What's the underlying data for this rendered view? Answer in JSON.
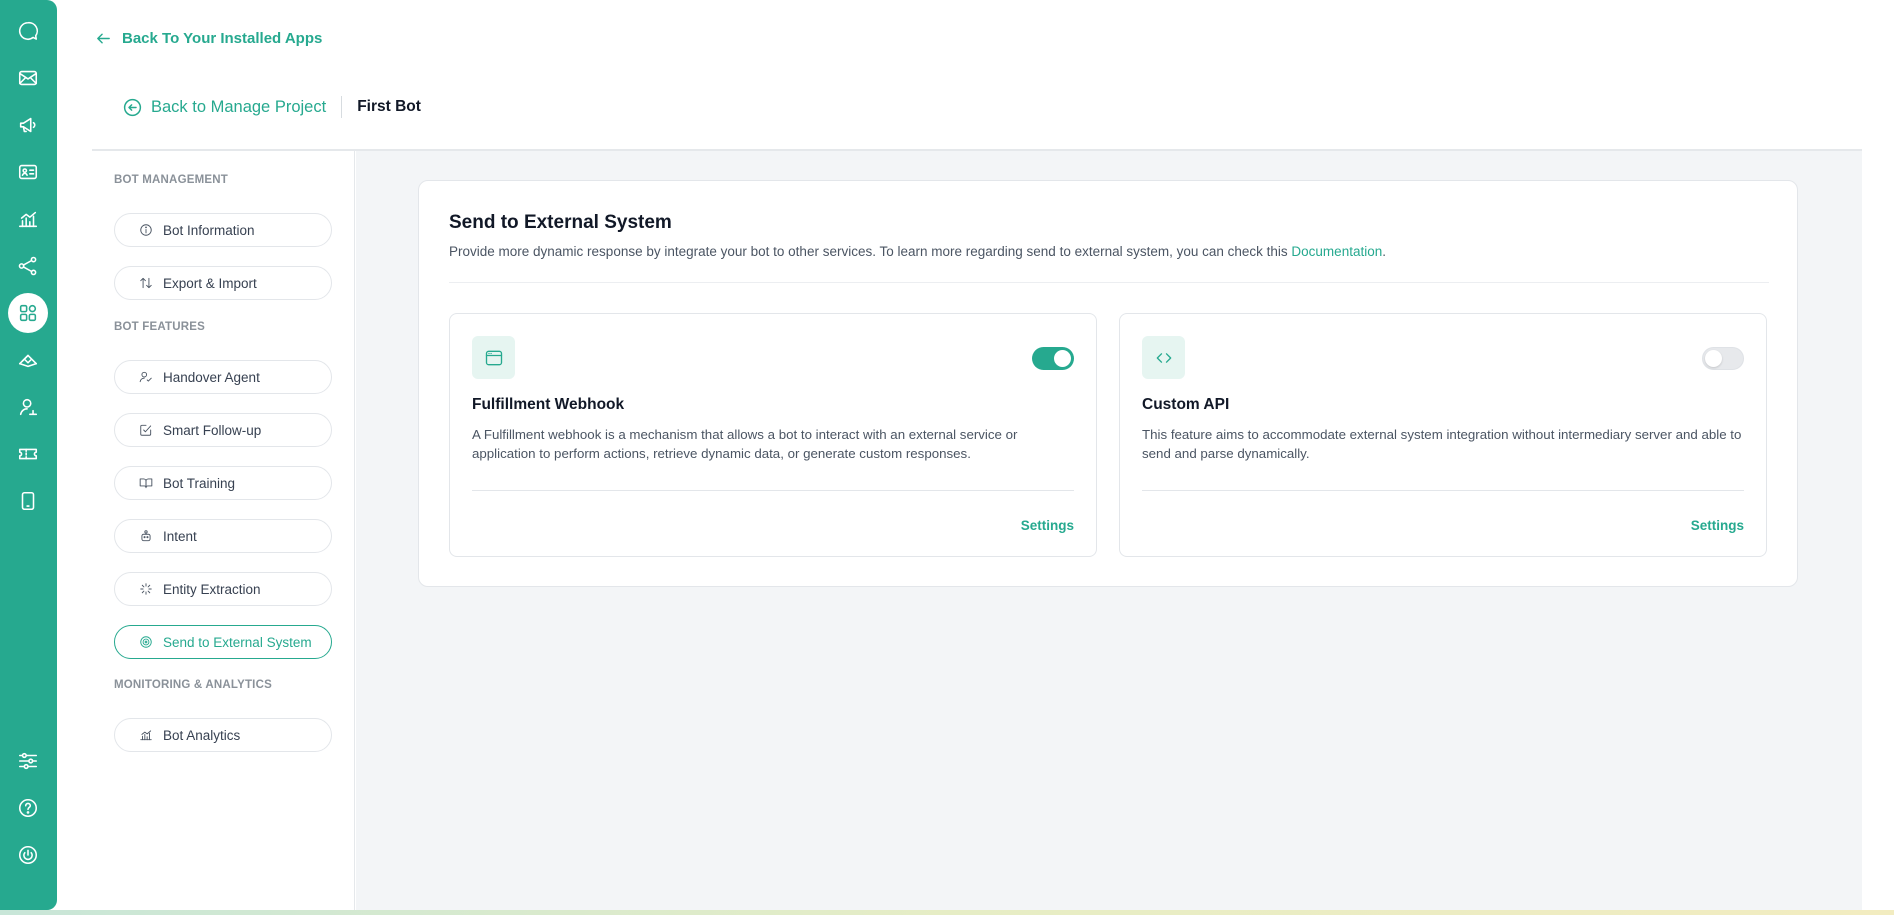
{
  "rail": {
    "icons": [
      "logo-chat-icon",
      "mail-icon",
      "megaphone-icon",
      "contact-card-icon",
      "analytics-icon",
      "share-nodes-icon",
      "apps-grid-icon",
      "layers-icon",
      "user-admin-icon",
      "ticket-icon",
      "mobile-device-icon",
      "sliders-icon",
      "help-icon",
      "power-icon"
    ],
    "active": "apps-grid-icon"
  },
  "header": {
    "back_apps": "Back To Your Installed Apps",
    "back_manage": "Back to Manage Project",
    "bot_name": "First Bot"
  },
  "sidebar": {
    "sections": [
      {
        "label": "BOT MANAGEMENT",
        "items": [
          {
            "label": "Bot Information",
            "icon": "info-icon"
          },
          {
            "label": "Export & Import",
            "icon": "arrows-updown-icon"
          }
        ]
      },
      {
        "label": "BOT FEATURES",
        "items": [
          {
            "label": "Handover Agent",
            "icon": "user-check-icon"
          },
          {
            "label": "Smart Follow-up",
            "icon": "edit-check-icon"
          },
          {
            "label": "Bot Training",
            "icon": "book-icon"
          },
          {
            "label": "Intent",
            "icon": "robot-icon"
          },
          {
            "label": "Entity Extraction",
            "icon": "sparkle-icon"
          },
          {
            "label": "Send to External System",
            "icon": "target-icon",
            "active": true
          }
        ]
      },
      {
        "label": "MONITORING & ANALYTICS",
        "items": [
          {
            "label": "Bot Analytics",
            "icon": "bar-chart-icon"
          }
        ]
      }
    ]
  },
  "main": {
    "title": "Send to External System",
    "description": "Provide more dynamic response by integrate your bot to other services. To learn more regarding send to external system, you can check this ",
    "doc_link": "Documentation",
    "doc_suffix": ".",
    "features": [
      {
        "title": "Fulfillment Webhook",
        "description": "A Fulfillment webhook is a mechanism that allows a bot to interact with an external service or application to perform actions, retrieve dynamic data, or generate custom responses.",
        "enabled": true,
        "settings_label": "Settings",
        "icon": "browser-window-icon"
      },
      {
        "title": "Custom API",
        "description": "This feature aims to accommodate external system integration without intermediary server and able to send and parse dynamically.",
        "enabled": false,
        "settings_label": "Settings",
        "icon": "code-icon"
      }
    ]
  },
  "colors": {
    "accent": "#26a98f",
    "accent_light": "#e6f5f1",
    "main_bg": "#f3f5f7"
  }
}
